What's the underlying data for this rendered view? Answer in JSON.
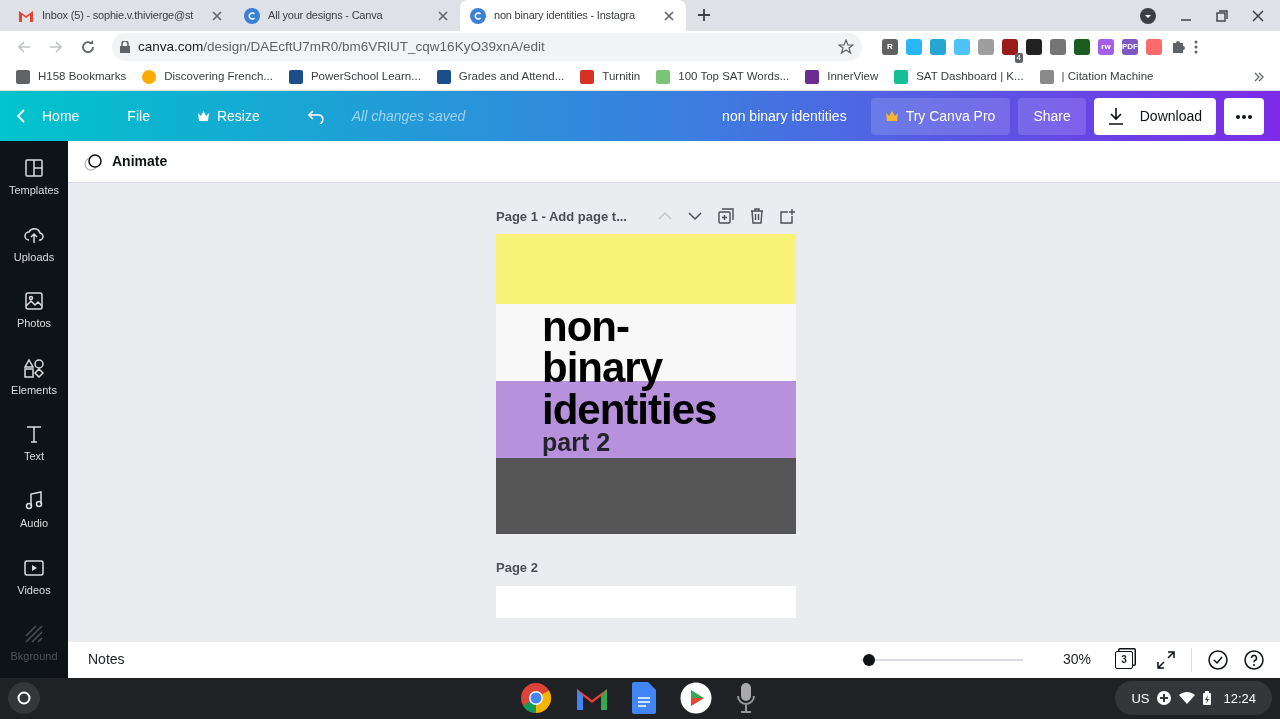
{
  "browser_tabs": [
    {
      "title": "Inbox (5) - sophie.v.thivierge@st",
      "selected": false
    },
    {
      "title": "All your designs - Canva",
      "selected": false
    },
    {
      "title": "non binary identities - Instagra",
      "selected": true
    }
  ],
  "address_bar": {
    "url_host": "canva.com",
    "url_path": "/design/DAEcftU7mR0/bm6VRlUT_cqw16KyO39xnA/edit"
  },
  "extensions": [
    {
      "label": "R",
      "color": "#616161"
    },
    {
      "color": "#29b6f6"
    },
    {
      "color": "#26a6d1"
    },
    {
      "color": "#4fc3f7"
    },
    {
      "color": "#9e9e9e"
    },
    {
      "badge": "4",
      "color": "#9b1c1c"
    },
    {
      "color": "#222222"
    },
    {
      "color": "#757575"
    },
    {
      "color": "#1b5e20"
    },
    {
      "label": "rw",
      "color": "#a55eea"
    },
    {
      "label": "PDF",
      "color": "#7e57c2"
    },
    {
      "color": "#ff6b6b"
    }
  ],
  "bookmarks": [
    {
      "label": "H158 Bookmarks",
      "color": "#5f6368"
    },
    {
      "label": "Discovering French...",
      "color": "#f9ab00"
    },
    {
      "label": "PowerSchool Learn...",
      "color": "#1b4f8a"
    },
    {
      "label": "Grades and Attend...",
      "color": "#1b4f8a"
    },
    {
      "label": "Turnitin",
      "color": "#d93025"
    },
    {
      "label": "100 Top SAT Words...",
      "color": "#7cc576"
    },
    {
      "label": "InnerView",
      "color": "#6a2c91"
    },
    {
      "label": "SAT Dashboard | K...",
      "color": "#14bf96"
    },
    {
      "label": "| Citation Machine",
      "color": "#8a8a8a"
    }
  ],
  "header": {
    "home": "Home",
    "file": "File",
    "resize": "Resize",
    "saved_status": "All changes saved",
    "design_title": "non binary identities",
    "try_pro": "Try Canva Pro",
    "share": "Share",
    "download": "Download"
  },
  "sidebar": {
    "items": [
      {
        "label": "Templates"
      },
      {
        "label": "Uploads"
      },
      {
        "label": "Photos"
      },
      {
        "label": "Elements"
      },
      {
        "label": "Text"
      },
      {
        "label": "Audio"
      },
      {
        "label": "Videos"
      },
      {
        "label": "Bkground",
        "faded": true
      }
    ]
  },
  "toolbar": {
    "animate": "Animate"
  },
  "pages": [
    {
      "label": "Page 1 - Add page t...",
      "title_lines": [
        "non-",
        "binary",
        "identities"
      ],
      "subtitle": "part 2",
      "stripes": [
        {
          "color": "#f9f377"
        },
        {
          "color": "#f8f8f8"
        },
        {
          "color": "#b891dd"
        },
        {
          "color": "#555555"
        }
      ]
    },
    {
      "label": "Page 2"
    }
  ],
  "bottom_bar": {
    "notes": "Notes",
    "zoom": {
      "level": 0.05
    },
    "zoom_reading": "30%",
    "page_count": "3"
  },
  "shelf": {
    "time": "12:24",
    "locale": "US"
  }
}
